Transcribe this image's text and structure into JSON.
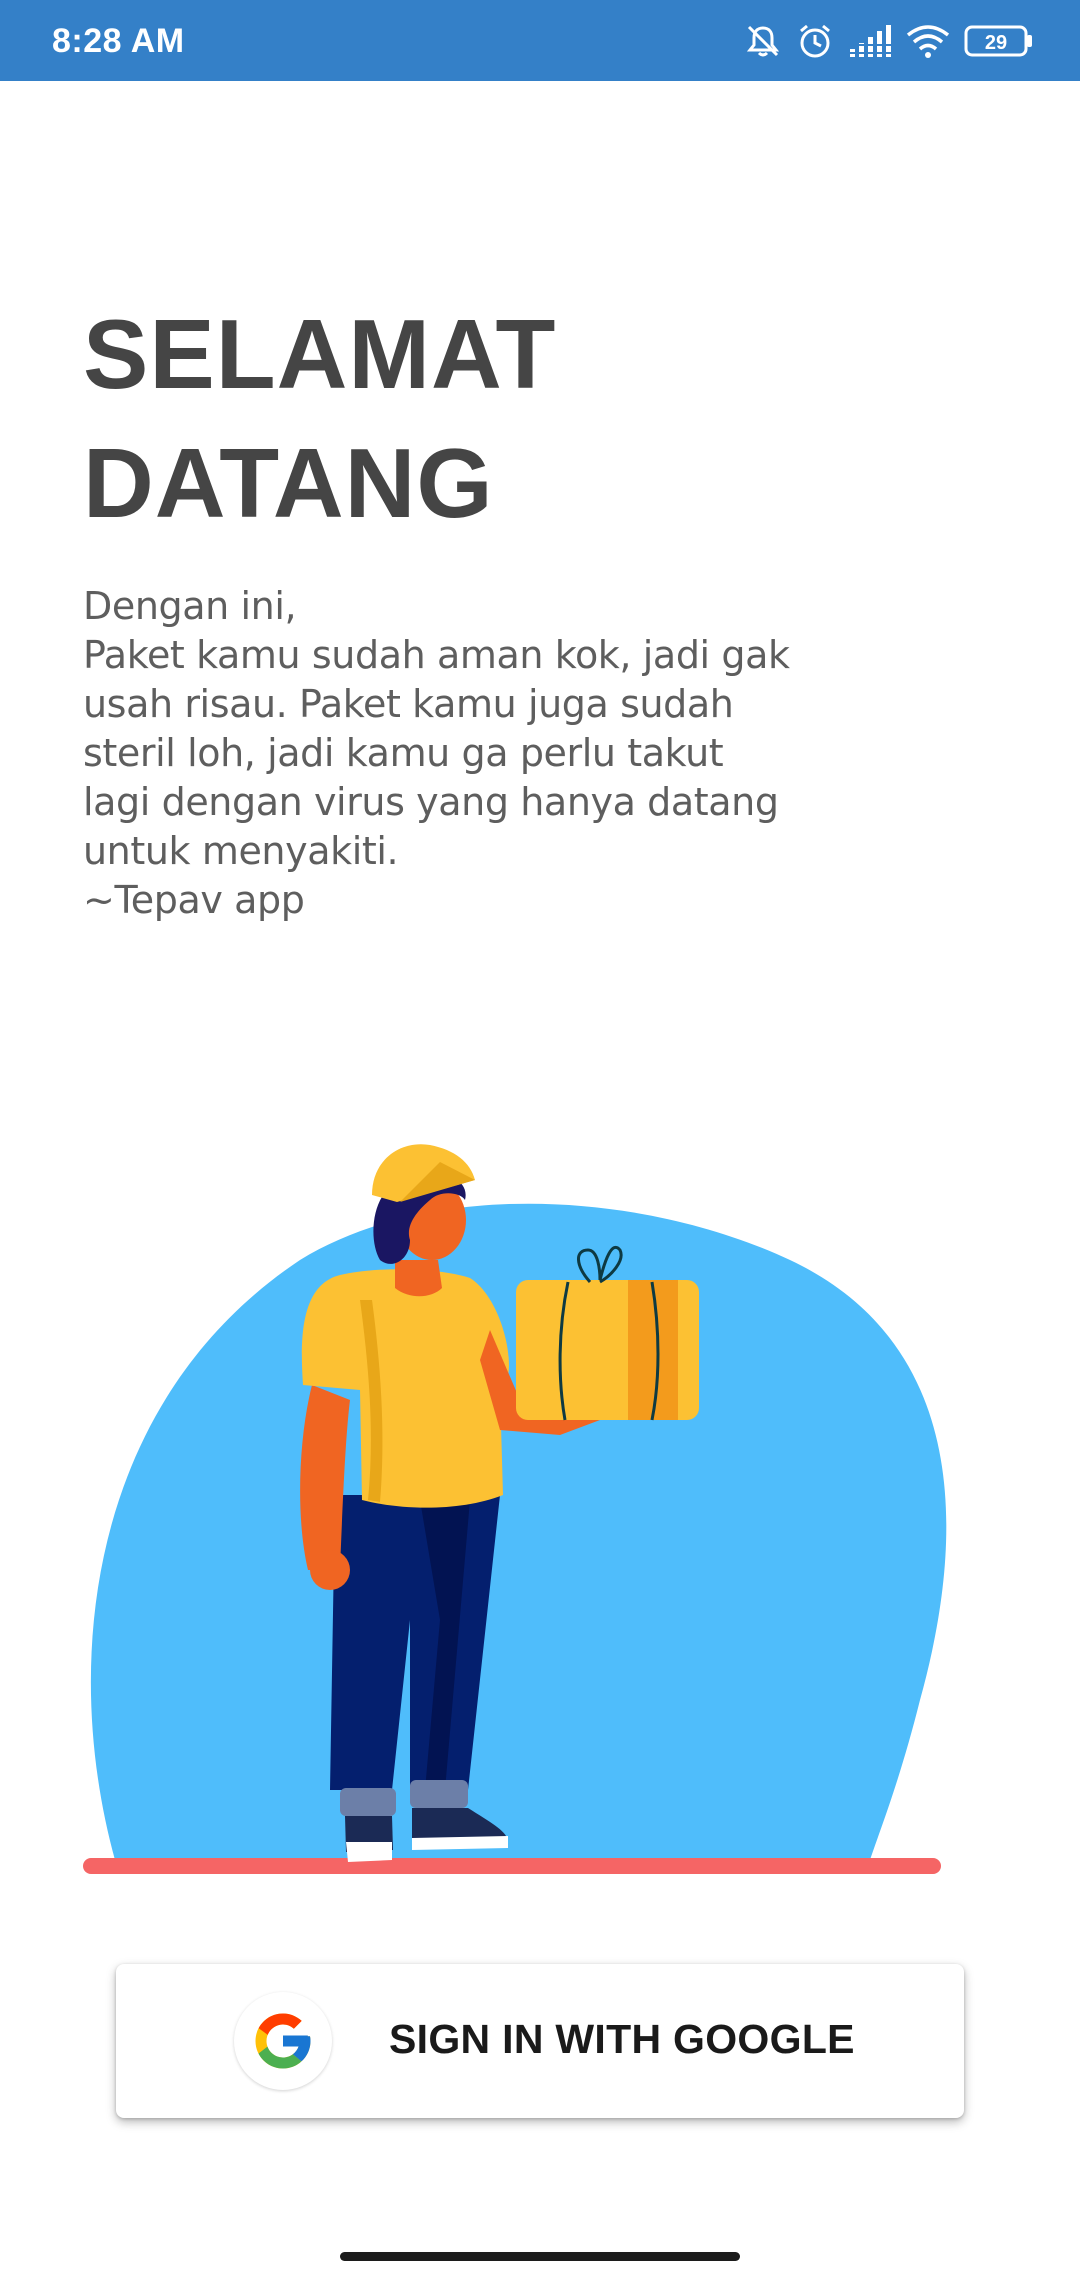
{
  "status_bar": {
    "time": "8:28 AM",
    "battery_level": "29",
    "background_color": "#3480c8",
    "icons": [
      "mute-icon",
      "alarm-icon",
      "signal-icon",
      "wifi-icon",
      "battery-icon"
    ]
  },
  "welcome": {
    "title_line_1": "SELAMAT",
    "title_line_2": "DATANG",
    "message_lines": [
      "Dengan ini,",
      "Paket kamu sudah aman kok, jadi gak",
      "usah risau. Paket kamu juga sudah",
      "steril loh, jadi kamu ga perlu takut",
      "lagi dengan virus yang hanya datang",
      "untuk menyakiti.",
      "~Tepav app"
    ]
  },
  "illustration": {
    "subject": "delivery courier holding a package",
    "background_color": "#4fbdfb",
    "ground_color": "#f56565"
  },
  "sign_in": {
    "label": "SIGN IN WITH GOOGLE",
    "icon": "google-icon"
  }
}
